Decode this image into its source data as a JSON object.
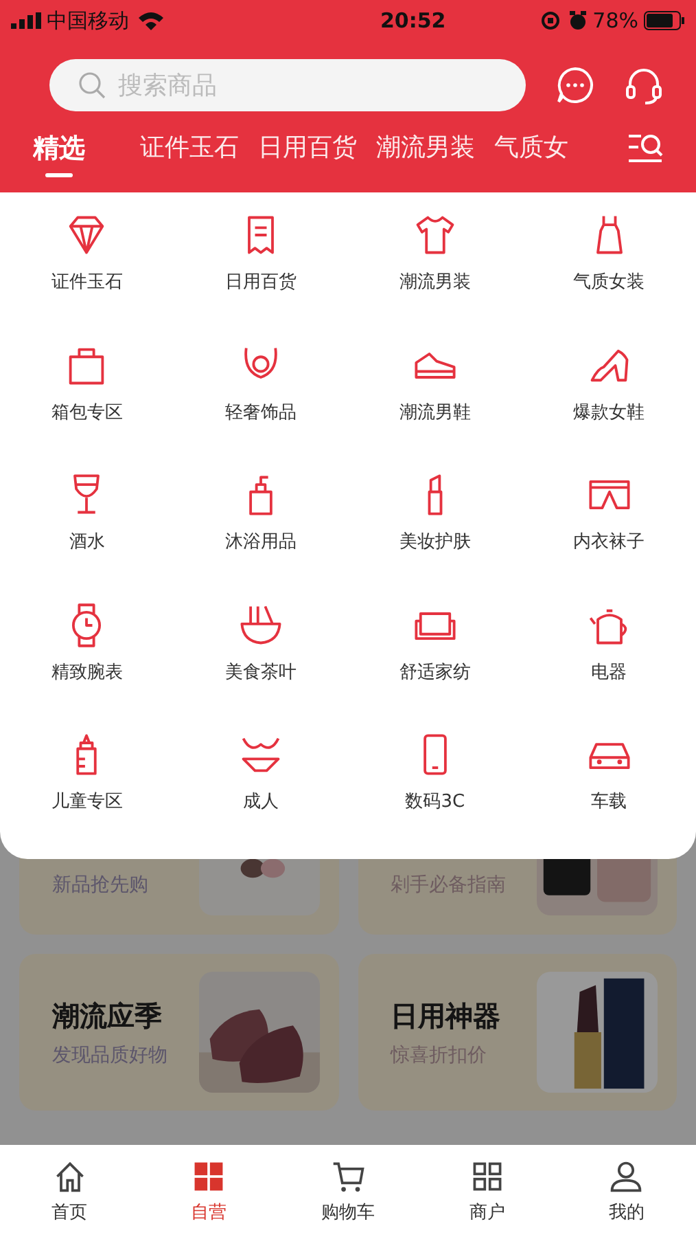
{
  "status_bar": {
    "carrier": "中国移动",
    "time": "20:52",
    "battery": "78%"
  },
  "search": {
    "placeholder": "搜索商品"
  },
  "tabs": [
    {
      "label": "精选",
      "selected": true
    },
    {
      "label": "证件玉石",
      "selected": false
    },
    {
      "label": "日用百货",
      "selected": false
    },
    {
      "label": "潮流男装",
      "selected": false
    },
    {
      "label": "气质女",
      "selected": false
    }
  ],
  "categories": [
    "证件玉石",
    "日用百货",
    "潮流男装",
    "气质女装",
    "箱包专区",
    "轻奢饰品",
    "潮流男鞋",
    "爆款女鞋",
    "酒水",
    "沐浴用品",
    "美妆护肤",
    "内衣袜子",
    "精致腕表",
    "美食茶叶",
    "舒适家纺",
    "电器",
    "儿童专区",
    "成人",
    "数码3C",
    "车载"
  ],
  "cards": [
    {
      "subtitle": "新品抢先购"
    },
    {
      "subtitle": "剁手必备指南"
    },
    {
      "title": "潮流应季",
      "subtitle": "发现品质好物"
    },
    {
      "title": "日用神器",
      "subtitle": "惊喜折扣价"
    }
  ],
  "bottom_nav": [
    {
      "label": "首页",
      "selected": false
    },
    {
      "label": "自营",
      "selected": true
    },
    {
      "label": "购物车",
      "selected": false
    },
    {
      "label": "商户",
      "selected": false
    },
    {
      "label": "我的",
      "selected": false
    }
  ]
}
